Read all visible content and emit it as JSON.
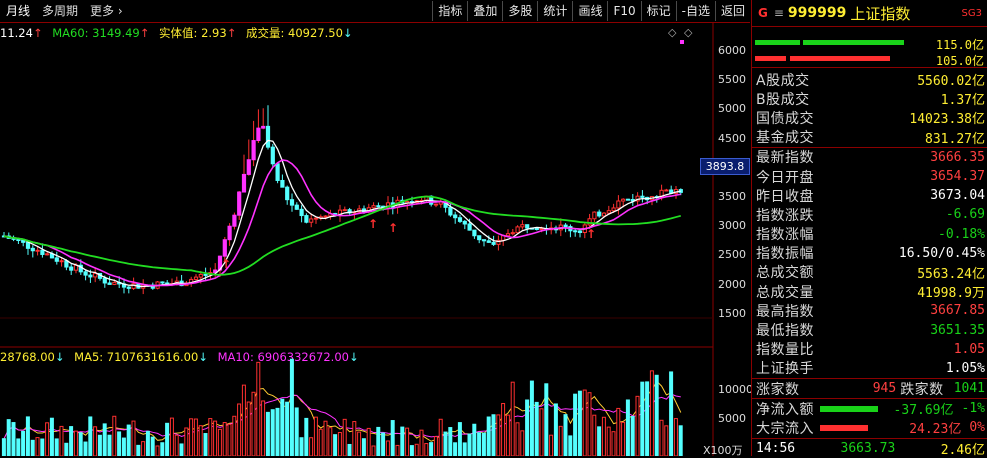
{
  "tabs": {
    "period": "月线",
    "multi": "多周期",
    "more": "更多"
  },
  "toolbar": [
    "指标",
    "叠加",
    "多股",
    "统计",
    "画线",
    "F10",
    "标记",
    "-自选",
    "返回"
  ],
  "legend_top": {
    "ma_prefix": "11.24",
    "ma60": "MA60: 3149.49",
    "entity": "实体值: 2.93",
    "volume": "成交量: 40927.50"
  },
  "legend_bottom": {
    "vol": "28768.00",
    "ma5": "MA5: 7107631616.00",
    "ma10": "MA10: 6906332672.00"
  },
  "price_axis": [
    "6000",
    "5500",
    "5000",
    "4500",
    "4000",
    "3500",
    "3000",
    "2500",
    "2000",
    "1500"
  ],
  "current_price": "3893.8",
  "volume_axis": [
    "10000",
    "5000"
  ],
  "volume_unit": "X100万",
  "colors": {
    "up": "#ff3030",
    "down": "#54ffff",
    "ma_white": "#ffffff",
    "ma_magenta": "#ff33ff",
    "ma_green": "#22dd22",
    "vol_ma_yellow": "#ffcc33",
    "border": "#8b0000"
  },
  "panel": {
    "g_icon": "G",
    "menu_icon": "≡",
    "code": "999999",
    "name": "上证指数",
    "sg": "SG3",
    "bars": [
      {
        "value": "115.0亿"
      },
      {
        "value": "105.0亿"
      }
    ],
    "rows1": [
      {
        "label": "A股成交",
        "value": "5560.02亿"
      },
      {
        "label": "B股成交",
        "value": "1.37亿"
      },
      {
        "label": "国债成交",
        "value": "14023.38亿"
      },
      {
        "label": "基金成交",
        "value": "831.27亿"
      }
    ],
    "rows2": [
      {
        "label": "最新指数",
        "value": "3666.35",
        "cls": "r"
      },
      {
        "label": "今日开盘",
        "value": "3654.37",
        "cls": "r"
      },
      {
        "label": "昨日收盘",
        "value": "3673.04",
        "cls": "w"
      },
      {
        "label": "指数涨跌",
        "value": "-6.69",
        "cls": "g"
      },
      {
        "label": "指数涨幅",
        "value": "-0.18%",
        "cls": "g"
      },
      {
        "label": "指数振幅",
        "value": "16.50/0.45%",
        "cls": "w"
      },
      {
        "label": "总成交额",
        "value": "5563.24亿",
        "cls": "y"
      },
      {
        "label": "总成交量",
        "value": "41998.9万",
        "cls": "y"
      },
      {
        "label": "最高指数",
        "value": "3667.85",
        "cls": "r"
      },
      {
        "label": "最低指数",
        "value": "3651.35",
        "cls": "g"
      },
      {
        "label": "指数量比",
        "value": "1.05",
        "cls": "r"
      },
      {
        "label": "上证换手",
        "value": "1.05%",
        "cls": "w"
      }
    ],
    "updown": {
      "up_label": "涨家数",
      "up": "945",
      "down_label": "跌家数",
      "down": "1041"
    },
    "flow": [
      {
        "label": "净流入额",
        "value": "-37.69亿",
        "pct": "-1%"
      },
      {
        "label": "大宗流入",
        "value": "24.23亿",
        "pct": "0%"
      }
    ],
    "bottom": {
      "time": "14:56",
      "price": "3663.73",
      "vol": "2.46亿"
    }
  }
}
